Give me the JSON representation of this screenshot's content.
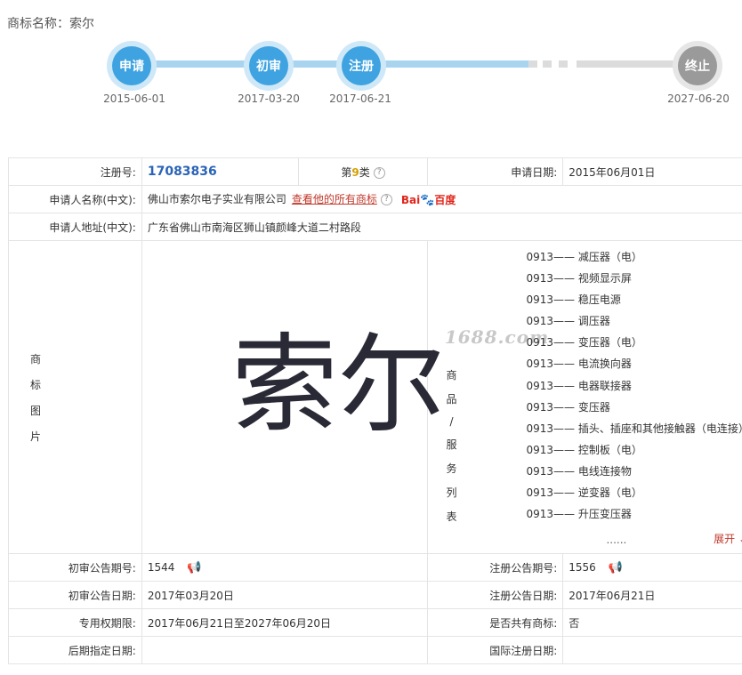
{
  "title": {
    "label": "商标名称：",
    "value": "索尔"
  },
  "timeline": {
    "steps": [
      {
        "label": "申请",
        "date": "2015-06-01"
      },
      {
        "label": "初审",
        "date": "2017-03-20"
      },
      {
        "label": "注册",
        "date": "2017-06-21"
      },
      {
        "label": "终止",
        "date": "2027-06-20"
      }
    ]
  },
  "info": {
    "reg_no_label": "注册号:",
    "reg_no": "17083836",
    "class_prefix": "第",
    "class_num": "9",
    "class_suffix": "类",
    "apply_date_label": "申请日期:",
    "apply_date": "2015年06月01日",
    "applicant_label": "申请人名称(中文):",
    "applicant": "佛山市索尔电子实业有限公司",
    "all_marks_link": "查看他的所有商标",
    "baidu_a": "Bai",
    "baidu_paw": "🐾",
    "baidu_b": "百度",
    "address_label": "申请人地址(中文):",
    "address": "广东省佛山市南海区狮山镇颜峰大道二村路段",
    "mark_img_label": [
      "商",
      "标",
      "图",
      "片"
    ],
    "mark_text": "索尔",
    "watermark": "1688.com",
    "services_label": [
      "商",
      "品",
      "/",
      "服",
      "务",
      "列",
      "表"
    ],
    "services": [
      "0913—— 减压器（电）",
      "0913—— 视频显示屏",
      "0913—— 稳压电源",
      "0913—— 调压器",
      "0913—— 变压器（电）",
      "0913—— 电流换向器",
      "0913—— 电器联接器",
      "0913—— 变压器",
      "0913—— 插头、插座和其他接触器（电连接）",
      "0913—— 控制板（电）",
      "0913—— 电线连接物",
      "0913—— 逆变器（电）",
      "0913—— 升压变压器"
    ],
    "ellipsis": "......",
    "expand": "展开 ⌄",
    "prelim_no_label": "初审公告期号:",
    "prelim_no": "1544",
    "reg_pub_no_label": "注册公告期号:",
    "reg_pub_no": "1556",
    "prelim_date_label": "初审公告日期:",
    "prelim_date": "2017年03月20日",
    "reg_pub_date_label": "注册公告日期:",
    "reg_pub_date": "2017年06月21日",
    "exclusive_label": "专用权期限:",
    "exclusive": "2017年06月21日至2027年06月20日",
    "shared_label": "是否共有商标:",
    "shared": "否",
    "later_label": "后期指定日期:",
    "later": "",
    "intl_label": "国际注册日期:",
    "intl": ""
  }
}
